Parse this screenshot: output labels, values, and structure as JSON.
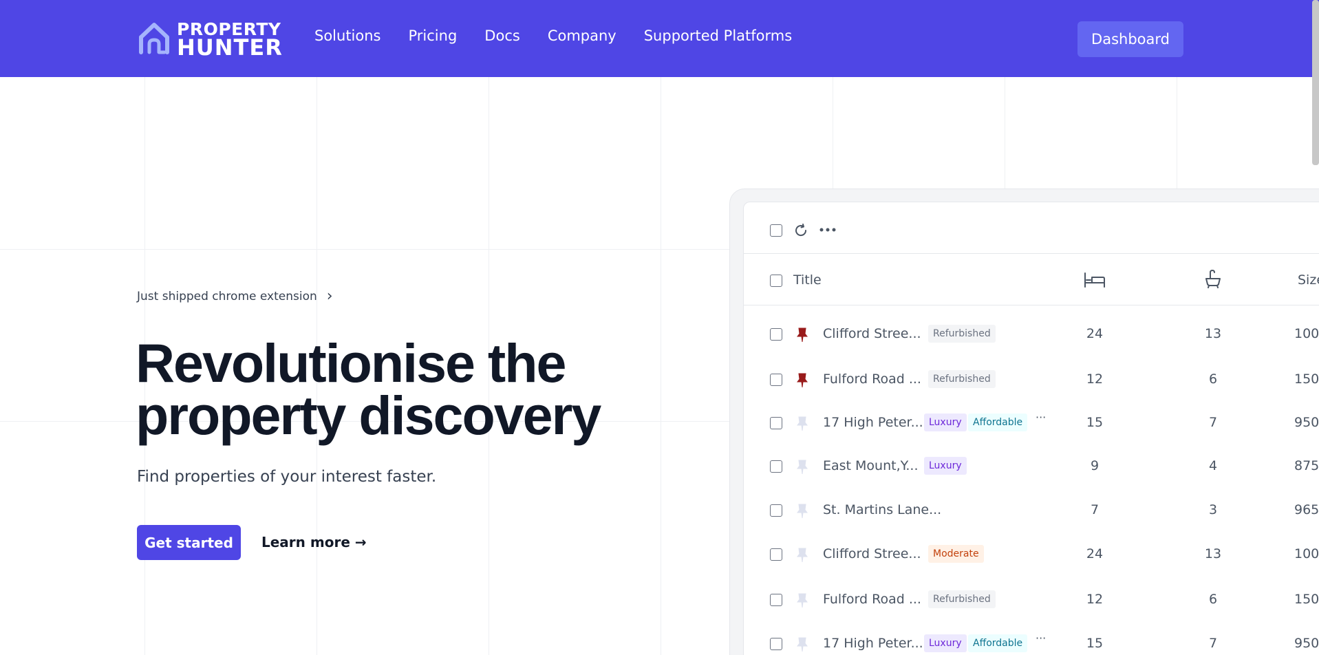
{
  "header": {
    "logo_line1": "PROPERTY",
    "logo_line2": "HUNTER",
    "menu": [
      "Solutions",
      "Pricing",
      "Docs",
      "Company",
      "Supported Platforms"
    ],
    "dashboard_label": "Dashboard"
  },
  "hero": {
    "announcement": "Just shipped chrome extension",
    "title": "Revolutionise the property discovery",
    "subtitle": "Find properties of your interest faster.",
    "primary_cta": "Get started",
    "secondary_cta": "Learn more →"
  },
  "table": {
    "columns": {
      "title": "Title",
      "beds_icon": "bed-icon",
      "baths_icon": "bathtub-icon",
      "size": "Size"
    },
    "rows": [
      {
        "title": "Clifford Stree...",
        "pinned": true,
        "tags": [
          "Refurbished"
        ],
        "more": false,
        "beds": "24",
        "baths": "13",
        "size": "100"
      },
      {
        "title": "Fulford Road ...",
        "pinned": true,
        "tags": [
          "Refurbished"
        ],
        "more": false,
        "beds": "12",
        "baths": "6",
        "size": "150"
      },
      {
        "title": "17 High Peter...",
        "pinned": false,
        "tags": [
          "Luxury",
          "Affordable"
        ],
        "more": true,
        "beds": "15",
        "baths": "7",
        "size": "950"
      },
      {
        "title": "East Mount,Y...",
        "pinned": false,
        "tags": [
          "Luxury"
        ],
        "more": false,
        "beds": "9",
        "baths": "4",
        "size": "875"
      },
      {
        "title": "St. Martins Lane...",
        "pinned": false,
        "tags": [],
        "more": false,
        "beds": "7",
        "baths": "3",
        "size": "965"
      },
      {
        "title": "Clifford Stree...",
        "pinned": false,
        "tags": [
          "Moderate"
        ],
        "more": false,
        "beds": "24",
        "baths": "13",
        "size": "100"
      },
      {
        "title": "Fulford Road ...",
        "pinned": false,
        "tags": [
          "Refurbished"
        ],
        "more": false,
        "beds": "12",
        "baths": "6",
        "size": "150"
      },
      {
        "title": "17 High Peter...",
        "pinned": false,
        "tags": [
          "Luxury",
          "Affordable"
        ],
        "more": true,
        "beds": "15",
        "baths": "7",
        "size": "950"
      }
    ]
  },
  "colors": {
    "brand": "#4f46e5",
    "pin_active": "#991b1b",
    "pin_inactive": "#dde1ee"
  }
}
